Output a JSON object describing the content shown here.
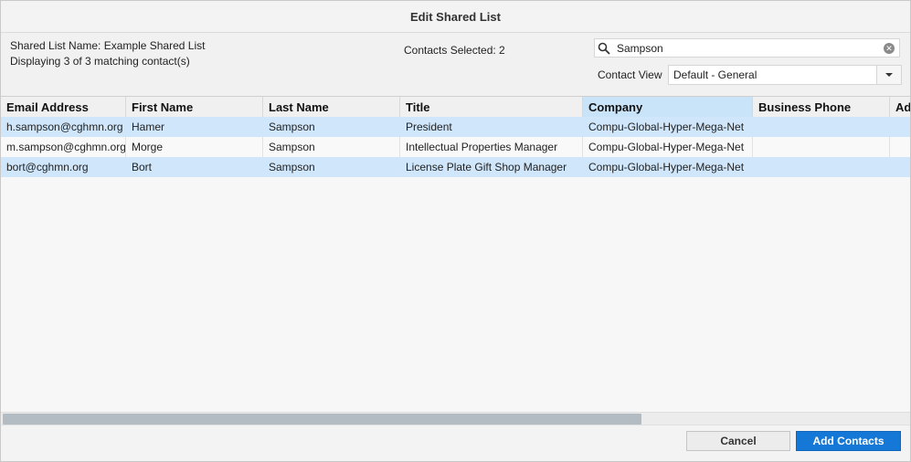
{
  "dialog": {
    "title": "Edit Shared List"
  },
  "info": {
    "list_name": "Shared List Name: Example Shared List",
    "displaying": "Displaying 3 of 3 matching contact(s)",
    "selected": "Contacts Selected: 2"
  },
  "search": {
    "value": "Sampson",
    "icon": "search-icon",
    "clear_icon": "clear-icon"
  },
  "contact_view": {
    "label": "Contact View",
    "selected": "Default - General"
  },
  "table": {
    "columns": [
      "Email Address",
      "First Name",
      "Last Name",
      "Title",
      "Company",
      "Business Phone",
      "Ad"
    ],
    "rows": [
      {
        "email": "h.sampson@cghmn.org",
        "first": "Hamer",
        "last": "Sampson",
        "title": "President",
        "company": "Compu-Global-Hyper-Mega-Net",
        "phone": "",
        "selected": true
      },
      {
        "email": "m.sampson@cghmn.org",
        "first": "Morge",
        "last": "Sampson",
        "title": "Intellectual Properties Manager",
        "company": "Compu-Global-Hyper-Mega-Net",
        "phone": "",
        "selected": false
      },
      {
        "email": "bort@cghmn.org",
        "first": "Bort",
        "last": "Sampson",
        "title": "License Plate Gift Shop Manager",
        "company": "Compu-Global-Hyper-Mega-Net",
        "phone": "",
        "selected": true
      }
    ]
  },
  "buttons": {
    "cancel": "Cancel",
    "add": "Add Contacts"
  },
  "colors": {
    "accent": "#1577d6",
    "row_selected": "#cfe6fb",
    "sorted_header": "#c9e4f9"
  }
}
